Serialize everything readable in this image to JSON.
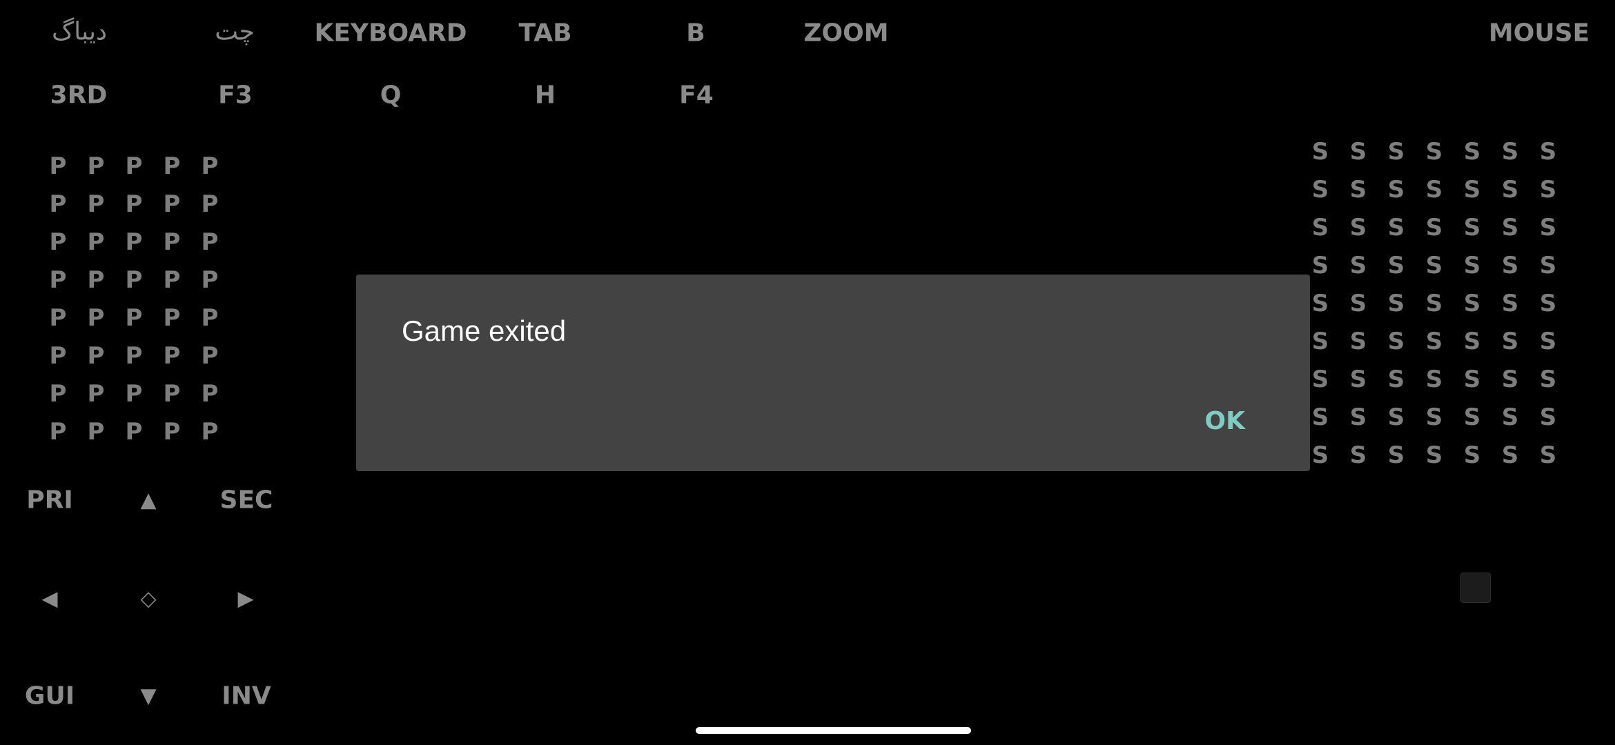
{
  "top_bar": {
    "row1": [
      "دیباگ",
      "چت",
      "KEYBOARD",
      "TAB",
      "B",
      "ZOOM",
      "MOUSE"
    ],
    "row2": [
      "3RD",
      "F3",
      "Q",
      "H",
      "F4"
    ]
  },
  "left_grid": {
    "key_label": "P",
    "rows": 8,
    "cols": 5
  },
  "right_grid": {
    "key_label": "S",
    "rows": 9,
    "cols": 7
  },
  "dpad": {
    "primary": "PRI",
    "up": "▲",
    "secondary": "SEC",
    "left": "◀",
    "center": "◇",
    "right": "▶",
    "gui": "GUI",
    "down": "▼",
    "inventory": "INV"
  },
  "dialog": {
    "message": "Game exited",
    "ok_label": "OK"
  },
  "colors": {
    "background": "#000000",
    "dialog_bg": "#434343",
    "key_text": "#8a8a8a",
    "accent": "#80cbc4"
  }
}
